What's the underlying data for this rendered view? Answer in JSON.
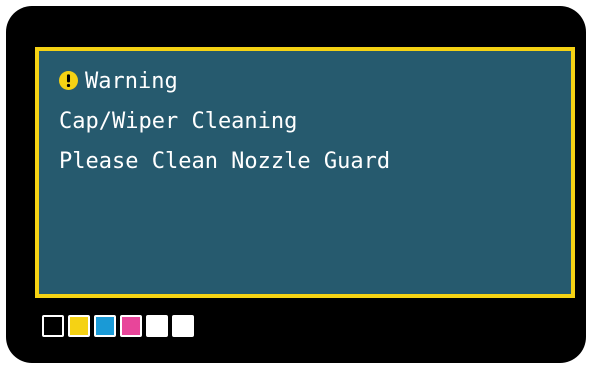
{
  "display": {
    "status_icon": "warning-icon",
    "status_label": "Warning",
    "message_line_1": "Cap/Wiper Cleaning",
    "message_line_2": "Please Clean Nozzle Guard"
  },
  "ink_indicators": [
    {
      "name": "black",
      "color": "#000000"
    },
    {
      "name": "yellow",
      "color": "#f5d214"
    },
    {
      "name": "cyan",
      "color": "#1a9ad6"
    },
    {
      "name": "magenta",
      "color": "#e8459a"
    },
    {
      "name": "white",
      "color": "#ffffff"
    },
    {
      "name": "white",
      "color": "#ffffff"
    }
  ],
  "colors": {
    "screen_background": "#265a6e",
    "screen_border": "#f5d214",
    "bezel": "#000000",
    "text": "#ffffff",
    "warning_icon": "#f5d214"
  }
}
